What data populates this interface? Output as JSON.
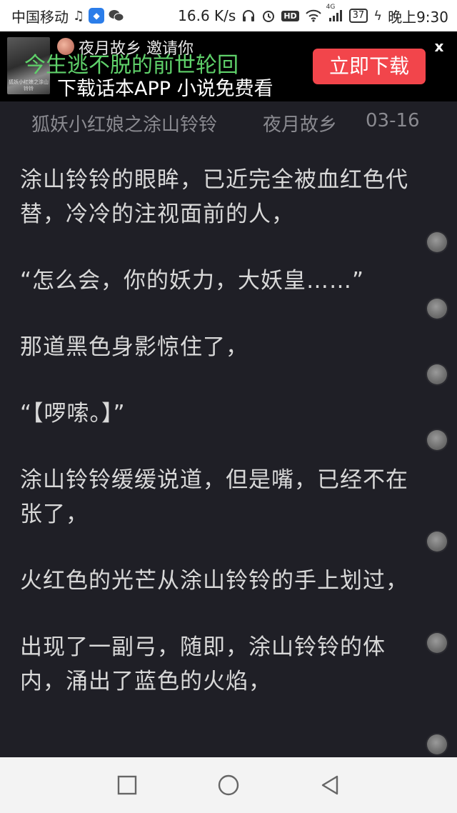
{
  "status_bar": {
    "carrier": "中国移动",
    "net_speed": "16.6 K/s",
    "network_type": "4G",
    "battery": "37",
    "time": "晚上9:30",
    "icons": [
      "music-icon",
      "shield-app-icon",
      "wechat-icon",
      "headphones-icon",
      "alarm-icon",
      "hd-icon",
      "wifi-icon",
      "signal-icon",
      "battery-icon",
      "charging-icon"
    ]
  },
  "ad": {
    "inviter_text": "夜月故乡 邀请你",
    "slogan": "今生逃不脱的前世轮回",
    "subtitle": "下载话本APP 小说免费看",
    "download_label": "立即下载",
    "close_label": "x",
    "thumb_caption": "狐妖小红娘之涂山\n铃铃",
    "accent_color": "#f2454b",
    "slogan_color": "#5fd16a"
  },
  "reader": {
    "title": "狐妖小红娘之涂山铃铃",
    "author": "夜月故乡",
    "date": "03-16",
    "background_color": "#1f1f26",
    "paragraphs": [
      "涂山铃铃的眼眸，已近完全被血红色代替，冷冷的注视面前的人，",
      "“怎么会，你的妖力，大妖皇……”",
      "那道黑色身影惊住了，",
      "“【啰嗦。】”",
      "涂山铃铃缓缓说道，但是嘴，已经不在张了，",
      "火红色的光芒从涂山铃铃的手上划过，",
      "出现了一副弓，随即，涂山铃铃的体内，涌出了蓝色的火焰，"
    ]
  },
  "nav_bar": {
    "buttons": [
      "recent-apps",
      "home",
      "back"
    ]
  }
}
